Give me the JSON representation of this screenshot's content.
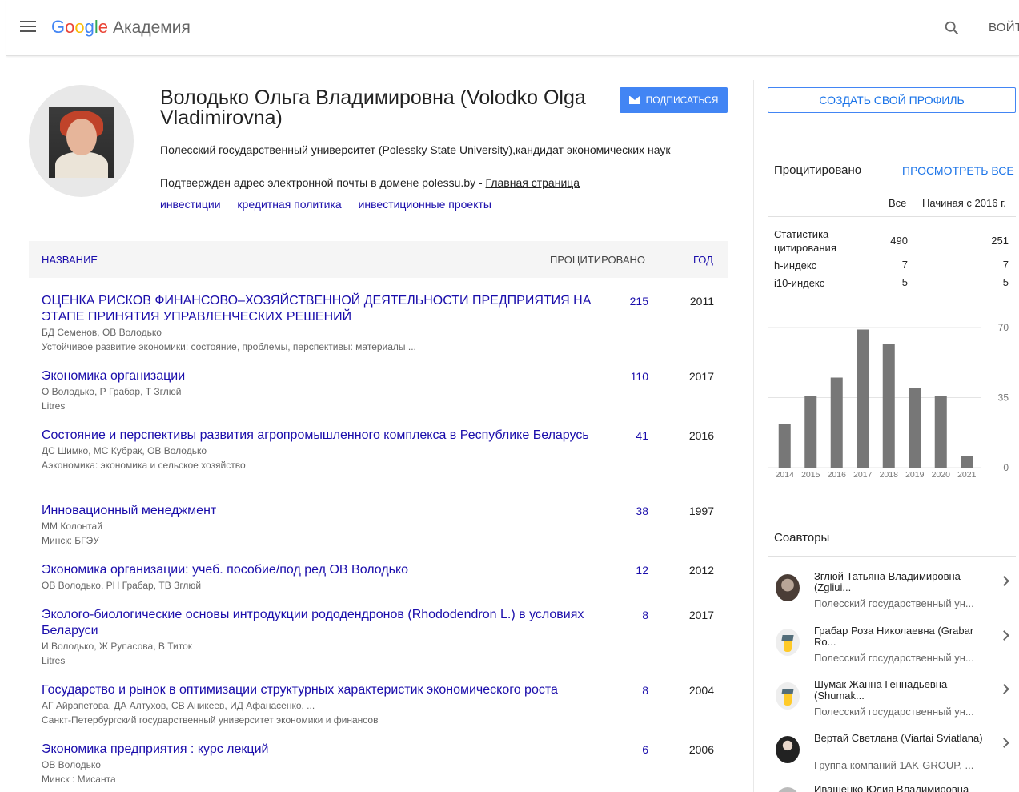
{
  "header": {
    "logo_letters": [
      "G",
      "o",
      "o",
      "g",
      "l",
      "e"
    ],
    "logo_suffix": "Академия",
    "login": "ВОЙТИ"
  },
  "profile": {
    "name": "Володько Ольга Владимировна (Volodko Olga Vladimirovna)",
    "subscribe": "ПОДПИСАТЬСЯ",
    "affiliation": "Полесский государственный университет (Polessky State University),кандидат экономических наук",
    "email_text": "Подтвержден адрес электронной почты в домене polessu.by - ",
    "homepage": "Главная страница",
    "interests": [
      "инвестиции",
      "кредитная политика",
      "инвестиционные проекты"
    ]
  },
  "table": {
    "col_title": "НАЗВАНИЕ",
    "col_cited": "ПРОЦИТИРОВАНО",
    "col_year": "ГОД",
    "rows": [
      {
        "title": "ОЦЕНКА РИСКОВ ФИНАНСОВО–ХОЗЯЙСТВЕННОЙ ДЕЯТЕЛЬНОСТИ ПРЕДПРИЯТИЯ НА ЭТАПЕ ПРИНЯТИЯ УПРАВЛЕНЧЕСКИХ РЕШЕНИЙ",
        "authors": "БД Семенов, ОВ Володько",
        "venue": "Устойчивое развитие экономики: состояние, проблемы, перспективы: материалы ...",
        "cited": "215",
        "year": "2011"
      },
      {
        "title": "Экономика организации",
        "authors": "О Володько, Р Грабар, Т Зглюй",
        "venue": "Litres",
        "cited": "110",
        "year": "2017"
      },
      {
        "title": "Состояние и перспективы развития агропромышленного комплекса в Республике Беларусь",
        "authors": "ДС Шимко, МС Кубрак, ОВ Володько",
        "venue": "Аэкономика: экономика и сельское хозяйство",
        "cited": "41",
        "year": "2016"
      },
      {
        "title": "Инновационный менеджмент",
        "authors": "ММ Колонтай",
        "venue": "Минск: БГЭУ",
        "cited": "38",
        "year": "1997"
      },
      {
        "title": "Экономика организации: учеб. пособие/под ред ОВ Володько",
        "authors": "ОВ Володько, РН Грабар, ТВ Зглюй",
        "venue": "",
        "cited": "12",
        "year": "2012"
      },
      {
        "title": "Эколого-биологические основы интродукции рододендронов (Rhododendron L.) в условиях Беларуси",
        "authors": "И Володько, Ж Рупасова, В Титок",
        "venue": "Litres",
        "cited": "8",
        "year": "2017"
      },
      {
        "title": "Государство и рынок в оптимизации структурных характеристик экономического роста",
        "authors": "АГ Айрапетова, ДА Алтухов, СВ Аникеев, ИД Афанасенко, ...",
        "venue": "Санкт-Петербургский государственный университет экономики и финансов",
        "cited": "8",
        "year": "2004"
      },
      {
        "title": "Экономика предприятия : курс лекций",
        "authors": "ОВ Володько",
        "venue": "Минск : Мисанта",
        "cited": "6",
        "year": "2006"
      }
    ]
  },
  "sidebar": {
    "create_profile": "СОЗДАТЬ СВОЙ ПРОФИЛЬ",
    "cited_by": "Процитировано",
    "view_all": "ПРОСМОТРЕТЬ ВСЕ",
    "col_all": "Все",
    "col_since": "Начиная с 2016 г.",
    "stats": [
      {
        "label": "Статистика цитирования",
        "all": "490",
        "since": "251"
      },
      {
        "label": "h-индекс",
        "all": "7",
        "since": "7"
      },
      {
        "label": "i10-индекс",
        "all": "5",
        "since": "5"
      }
    ],
    "coauthors_heading": "Соавторы",
    "coauthors": [
      {
        "name": "Зглюй Татьяна Владимировна (Zgliui...",
        "aff": "Полесский государственный ун...",
        "avatar": "photo"
      },
      {
        "name": "Грабар Роза Николаевна (Grabar Ro...",
        "aff": "Полесский государственный ун...",
        "avatar": "graduation-cap"
      },
      {
        "name": "Шумак Жанна Геннадьевна (Shumak...",
        "aff": "Полесский государственный ун...",
        "avatar": "graduation-cap"
      },
      {
        "name": "Вертай Светлана (Viartai Sviatlana)",
        "aff": "Группа компаний 1AK-GROUP, ...",
        "avatar": "photo"
      },
      {
        "name": "Ивашенко Юлия Владимировна",
        "aff": "",
        "avatar": "photo"
      }
    ]
  },
  "chart_data": {
    "type": "bar",
    "categories": [
      "2014",
      "2015",
      "2016",
      "2017",
      "2018",
      "2019",
      "2020",
      "2021"
    ],
    "values": [
      22,
      36,
      45,
      69,
      62,
      40,
      36,
      6
    ],
    "ylim": [
      0,
      70
    ],
    "yticks": [
      "70",
      "35",
      "0"
    ],
    "bar_color": "#777777"
  }
}
